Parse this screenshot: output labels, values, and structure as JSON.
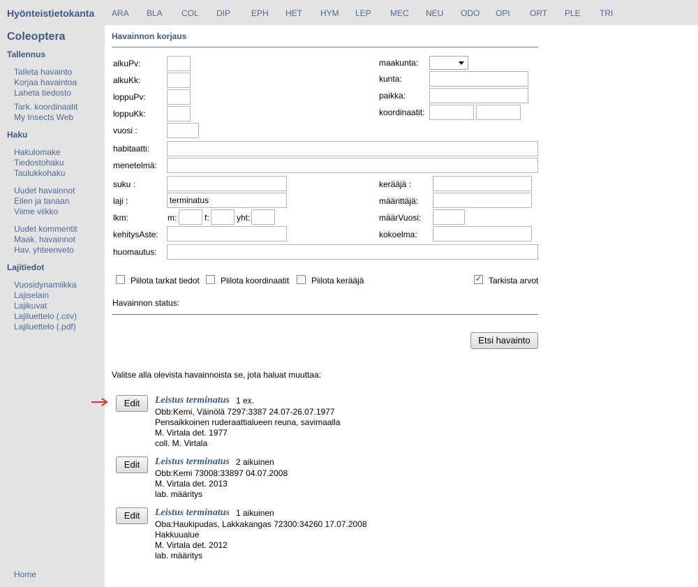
{
  "header": {
    "brand": "Hyönteistietokanta",
    "nav": [
      "ARA",
      "BLA",
      "COL",
      "DIP",
      "EPH",
      "HET",
      "HYM",
      "LEP",
      "MEC",
      "NEU",
      "ODO",
      "OPI",
      "ORT",
      "PLE",
      "TRI"
    ]
  },
  "sidebar": {
    "title": "Coleoptera",
    "sections": [
      {
        "heading": "Tallennus",
        "links": [
          "Talleta havainto",
          "Korjaa havaintoa",
          "Laheta tiedosto",
          "Tark. koordinaatit",
          "My Insects Web"
        ]
      },
      {
        "heading": "Haku",
        "links": [
          "Hakulomake",
          "Tiedostohaku",
          "Taulukkohaku",
          "Uudet havainnot",
          "Eilen ja tanaan",
          "Viime viikko",
          "Uudet kommentit",
          "Maak. havainnot",
          "Hav. yhteenveto"
        ]
      },
      {
        "heading": "Lajitiedot",
        "links": [
          "Vuosidynamiikka",
          "Lajiselain",
          "Lajikuvat",
          "Lajiluettelo (.csv)",
          "Lajiluettelo (.pdf)"
        ]
      }
    ],
    "home": "Home"
  },
  "form": {
    "title": "Havainnon korjaus",
    "labels": {
      "alkuPv": "alkuPv:",
      "alkuKk": "alkuKk:",
      "loppuPv": "loppuPv:",
      "loppuKk": "loppuKk:",
      "vuosi": "vuosi :",
      "habitaatti": "habitaatti:",
      "menetelma": "menetelmä:",
      "suku": "suku :",
      "laji": "laji :",
      "lkm": "lkm:",
      "m": "m:",
      "f": "f:",
      "yht": "yht:",
      "kehitysAste": "kehitysAste:",
      "huomautus": "huomautus:",
      "maakunta": "maakunta:",
      "kunta": "kunta:",
      "paikka": "paikka:",
      "koordinaatit": "koordinaatit:",
      "keraaja": "kerääjä :",
      "maarittaja": "määrittäjä:",
      "maarVuosi": "määrVuosi:",
      "kokoelma": "kokoelma:"
    },
    "values": {
      "laji": "terminatus"
    },
    "checkboxes": {
      "hide_details": "Piilota tarkat tiedot",
      "hide_coords": "Piilota koordinaatit",
      "hide_collector": "Piilota kerääjä",
      "check_values": "Tarkista arvot"
    },
    "status_label": "Havainnon status:",
    "search_button": "Etsi havainto"
  },
  "results": {
    "instruction": "Valitse alla olevista havainnoista se, jota haluat muuttaa:",
    "edit_label": "Edit",
    "items": [
      {
        "species": "Leistus terminatus",
        "count": "1 ex.",
        "lines": [
          "Obb:Kemi, Väinölä 7297:3387  24.07-26.07.1977",
          "Pensaikkoinen ruderaattialueen reuna, savimaalla",
          "M. Virtala det. 1977",
          "coll. M. Virtala"
        ]
      },
      {
        "species": "Leistus terminatus",
        "count": "2 aikuinen",
        "lines": [
          "Obb:Kemi 73008:33897  04.07.2008",
          "M. Virtala det. 2013",
          "lab. määritys"
        ]
      },
      {
        "species": "Leistus terminatus",
        "count": "1 aikuinen",
        "lines": [
          "Oba:Haukipudas, Lakkakangas 72300:34260  17.07.2008",
          "Hakkuualue",
          "M. Virtala det. 2012",
          "lab. määritys"
        ]
      }
    ]
  },
  "colors": {
    "accent": "#3b5a86",
    "sidebar_bg": "#e3e3e3",
    "arrow": "#e0302a"
  }
}
